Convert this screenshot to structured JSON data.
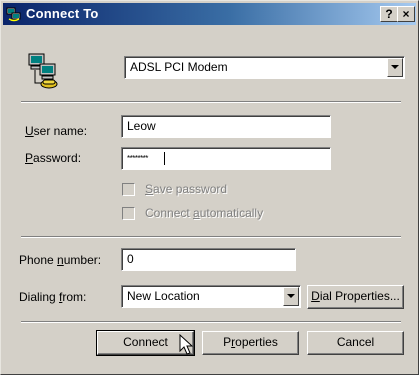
{
  "window": {
    "title": "Connect To",
    "help_button": "?",
    "close_button": "×"
  },
  "connection": {
    "device": "ADSL PCI Modem"
  },
  "user_name": {
    "label_prefix": "",
    "label_key": "U",
    "label_rest": "ser name:",
    "value": "Leow"
  },
  "password": {
    "label_key": "P",
    "label_rest": "assword:",
    "value": "********"
  },
  "save_password": {
    "label_key": "S",
    "label_rest": "ave password",
    "checked": false
  },
  "connect_automatically": {
    "label_prefix": "Connect ",
    "label_key": "a",
    "label_rest": "utomatically",
    "checked": false
  },
  "phone_number": {
    "label_prefix": "Phone ",
    "label_key": "n",
    "label_rest": "umber:",
    "value": "0"
  },
  "dialing_from": {
    "label_prefix": "Dialing ",
    "label_key": "f",
    "label_rest": "rom:",
    "value": "New Location",
    "properties_key": "D",
    "properties_rest": "ial Properties..."
  },
  "buttons": {
    "connect": "Connect",
    "properties_prefix": "P",
    "properties_key": "r",
    "properties_rest": "operties",
    "cancel": "Cancel"
  },
  "icons": [
    "network-connection-icon",
    "dialup-computers-icon",
    "dropdown-arrow-icon",
    "mouse-cursor-icon"
  ]
}
